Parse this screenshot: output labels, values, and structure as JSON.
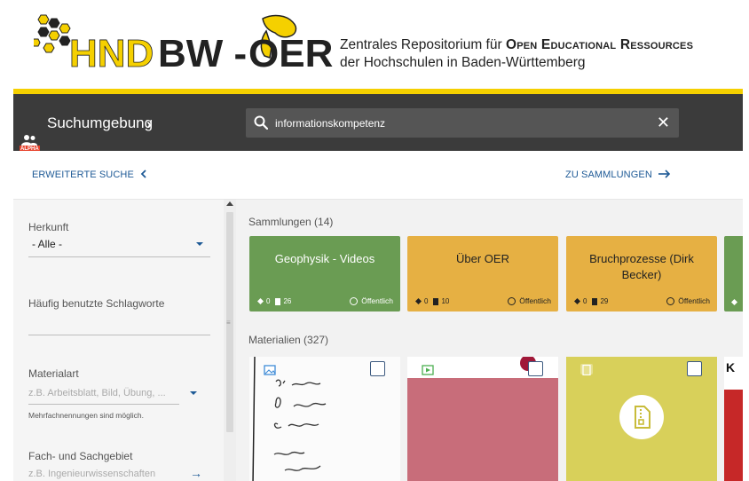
{
  "header": {
    "logo_text": "HND BW - OER",
    "tagline_line1_prefix": "Zentrales Repositorium für ",
    "tagline_line1_sc": "Open Educational Ressources",
    "tagline_line2": "der Hochschulen in Baden-Württemberg",
    "accent_color": "#f5d000"
  },
  "toolbar": {
    "alpha_badge": "ALPHA",
    "env_label": "Suchumgebung",
    "env_chevron": "›",
    "search_value": "informationskompetenz",
    "clear_icon": "✕"
  },
  "subnav": {
    "advanced_search": "ERWEITERTE SUCHE",
    "to_collections": "ZU SAMMLUNGEN"
  },
  "sidebar": {
    "origin_label": "Herkunft",
    "origin_value": "- Alle -",
    "keywords_label": "Häufig benutzte Schlagworte",
    "material_label": "Materialart",
    "material_placeholder": "z.B. Arbeitsblatt, Bild, Übung, ...",
    "material_hint": "Mehrfachnennungen sind möglich.",
    "subject_label": "Fach- und Sachgebiet",
    "subject_placeholder": "z.B. Ingenieurwissenschaften"
  },
  "main": {
    "collections_title": "Sammlungen (14)",
    "materials_title": "Materialien (327)",
    "collections": [
      {
        "title": "Geophysik - Videos",
        "shapes": "0",
        "docs": "26",
        "visibility": "Öffentlich",
        "color": "#6a9c53"
      },
      {
        "title": "Über OER",
        "shapes": "0",
        "docs": "10",
        "visibility": "Öffentlich",
        "color": "#e6b043"
      },
      {
        "title": "Bruchprozesse (Dirk Becker)",
        "shapes": "0",
        "docs": "29",
        "visibility": "Öffentlich",
        "color": "#e6b043"
      }
    ],
    "materials": [
      {
        "type_icon": "image-icon",
        "bg": "#ffffff"
      },
      {
        "type_icon": "video-icon",
        "bg": "#c86d7a"
      },
      {
        "type_icon": "file-icon",
        "bg": "#d8d05a"
      },
      {
        "partial_text": "K",
        "bg": "#c62828"
      }
    ]
  }
}
